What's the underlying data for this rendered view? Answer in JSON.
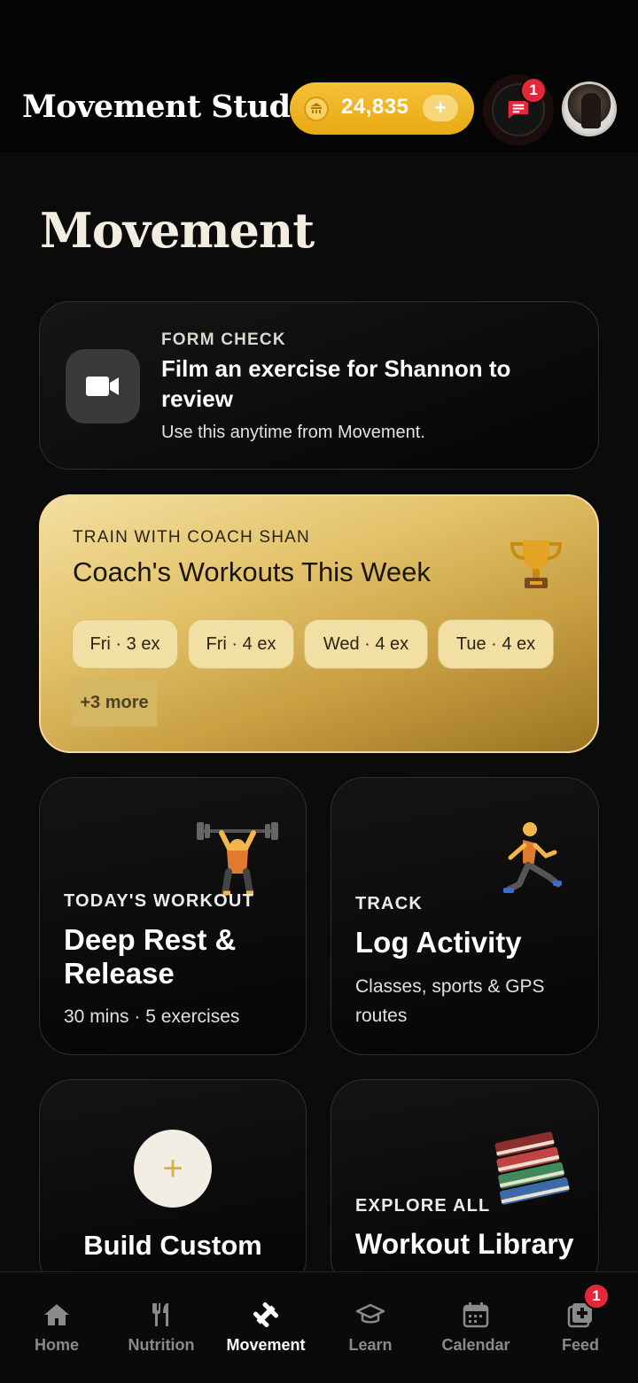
{
  "header": {
    "app_title": "Movement Studio",
    "coins": "24,835",
    "coin_plus": "+",
    "messages_badge": "1"
  },
  "page": {
    "title": "Movement"
  },
  "form_check": {
    "eyebrow": "FORM CHECK",
    "title": "Film an exercise for Shannon to review",
    "subtitle": "Use this anytime from Movement."
  },
  "coach": {
    "eyebrow": "TRAIN WITH COACH SHAN",
    "title": "Coach's Workouts This Week",
    "chips": [
      "Fri · 3 ex",
      "Fri · 4 ex",
      "Wed · 4 ex",
      "Tue · 4 ex"
    ],
    "more": "+3 more"
  },
  "today": {
    "eyebrow": "TODAY'S WORKOUT",
    "title_line1": "Deep Rest &",
    "title_line2": "Release",
    "subtitle": "30 mins · 5 exercises"
  },
  "track": {
    "eyebrow": "TRACK",
    "title": "Log Activity",
    "subtitle_line1": "Classes, sports & GPS",
    "subtitle_line2": "routes"
  },
  "build": {
    "plus": "+",
    "title": "Build Custom"
  },
  "library": {
    "eyebrow": "EXPLORE ALL",
    "title": "Workout Library"
  },
  "nav": {
    "items": [
      {
        "label": "Home",
        "icon": "home-icon"
      },
      {
        "label": "Nutrition",
        "icon": "fork-knife-icon"
      },
      {
        "label": "Movement",
        "icon": "dumbbell-icon"
      },
      {
        "label": "Learn",
        "icon": "graduation-cap-icon"
      },
      {
        "label": "Calendar",
        "icon": "calendar-icon"
      },
      {
        "label": "Feed",
        "icon": "feed-plus-icon"
      }
    ],
    "active": "Movement",
    "feed_badge": "1"
  },
  "colors": {
    "gold": "#e9a913",
    "badge_red": "#e5273a",
    "nav_inactive": "#8a8a8a"
  }
}
